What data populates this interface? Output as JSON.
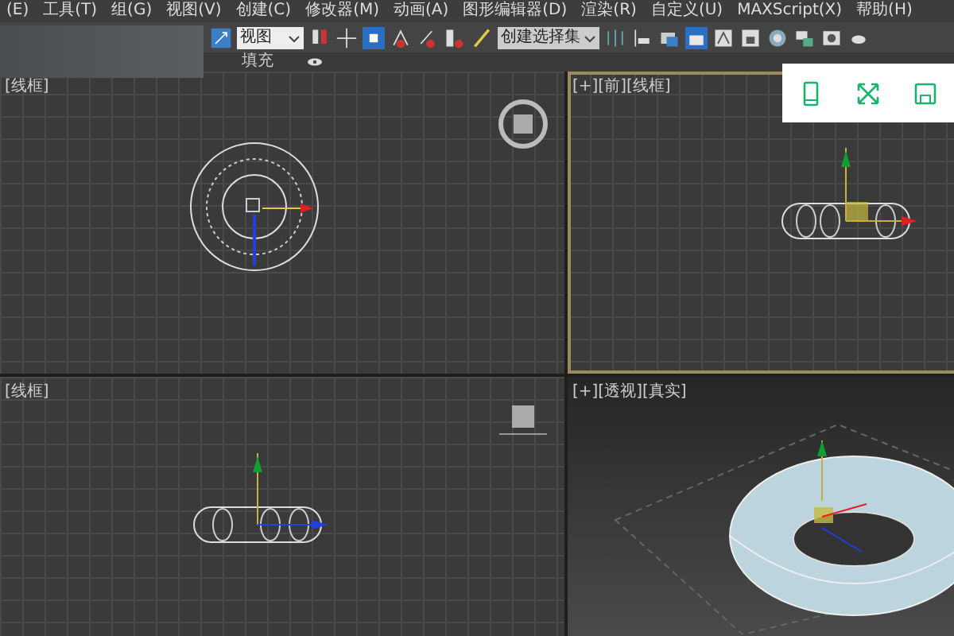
{
  "menu_bar": {
    "items": [
      "(E)",
      "工具(T)",
      "组(G)",
      "视图(V)",
      "创建(C)",
      "修改器(M)",
      "动画(A)",
      "图形编辑器(D)",
      "渲染(R)",
      "自定义(U)",
      "MAXScript(X)",
      "帮助(H)"
    ]
  },
  "toolbar": {
    "reference_dropdown": "视图",
    "selection_set_dropdown": "创建选择集"
  },
  "ribbon": {
    "tabs": [
      "填充"
    ]
  },
  "viewports": [
    {
      "label": "[线框]",
      "kind": "top",
      "active": false
    },
    {
      "label": "[+][前][线框]",
      "kind": "front",
      "active": true
    },
    {
      "label": "[线框]",
      "kind": "left",
      "active": false
    },
    {
      "label": "[+][透视][真实]",
      "kind": "perspective",
      "active": false
    }
  ]
}
